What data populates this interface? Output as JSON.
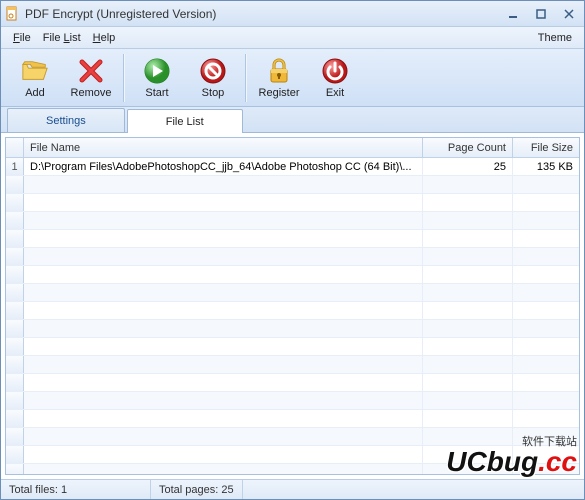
{
  "window": {
    "title": "PDF Encrypt (Unregistered Version)"
  },
  "menubar": {
    "file": "File",
    "filelist": "File List",
    "help": "Help",
    "theme": "Theme"
  },
  "toolbar": {
    "add": "Add",
    "remove": "Remove",
    "start": "Start",
    "stop": "Stop",
    "register": "Register",
    "exit": "Exit"
  },
  "tabs": {
    "settings": "Settings",
    "filelist": "File List",
    "active": "filelist"
  },
  "grid": {
    "headers": {
      "filename": "File Name",
      "pagecount": "Page Count",
      "filesize": "File Size"
    },
    "rows": [
      {
        "index": "1",
        "filename": "D:\\Program Files\\AdobePhotoshopCC_jjb_64\\Adobe Photoshop CC (64 Bit)\\...",
        "pagecount": "25",
        "filesize": "135 KB"
      }
    ],
    "empty_row_count": 18
  },
  "statusbar": {
    "total_files_label": "Total files:",
    "total_files_value": "1",
    "total_pages_label": "Total pages:",
    "total_pages_value": "25"
  },
  "watermark": {
    "sub": "软件下载站",
    "main_a": "UCbug",
    "main_b": ".cc"
  }
}
